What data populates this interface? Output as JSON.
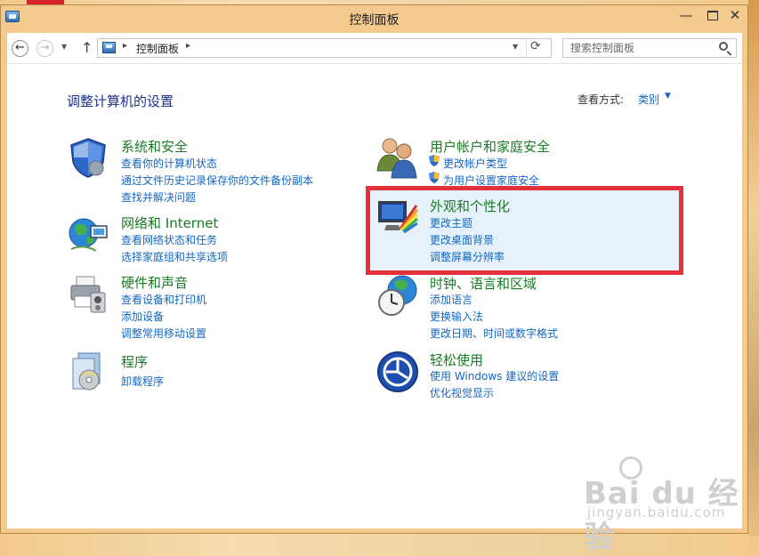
{
  "window": {
    "title": "控制面板"
  },
  "nav": {
    "breadcrumb": "控制面板",
    "search_placeholder": "搜索控制面板"
  },
  "page": {
    "title": "调整计算机的设置",
    "view_label": "查看方式:",
    "view_value": "类别"
  },
  "categories": [
    {
      "title": "系统和安全",
      "links": [
        "查看你的计算机状态",
        "通过文件历史记录保存你的文件备份副本",
        "查找并解决问题"
      ]
    },
    {
      "title": "网络和 Internet",
      "links": [
        "查看网络状态和任务",
        "选择家庭组和共享选项"
      ]
    },
    {
      "title": "硬件和声音",
      "links": [
        "查看设备和打印机",
        "添加设备",
        "调整常用移动设置"
      ]
    },
    {
      "title": "程序",
      "links": [
        "卸载程序"
      ]
    },
    {
      "title": "用户帐户和家庭安全",
      "links": [
        "更改帐户类型",
        "为用户设置家庭安全"
      ]
    },
    {
      "title": "外观和个性化",
      "links": [
        "更改主题",
        "更改桌面背景",
        "调整屏幕分辨率"
      ]
    },
    {
      "title": "时钟、语言和区域",
      "links": [
        "添加语言",
        "更换输入法",
        "更改日期、时间或数字格式"
      ]
    },
    {
      "title": "轻松使用",
      "links": [
        "使用 Windows 建议的设置",
        "优化视觉显示"
      ]
    }
  ],
  "watermark": {
    "text": "Bai du 经验",
    "url": "jingyan.baidu.com"
  },
  "colors": {
    "category_title": "#1a7b24",
    "link": "#1467c3",
    "page_title": "#1e3287",
    "highlight_border": "#e3303a"
  }
}
